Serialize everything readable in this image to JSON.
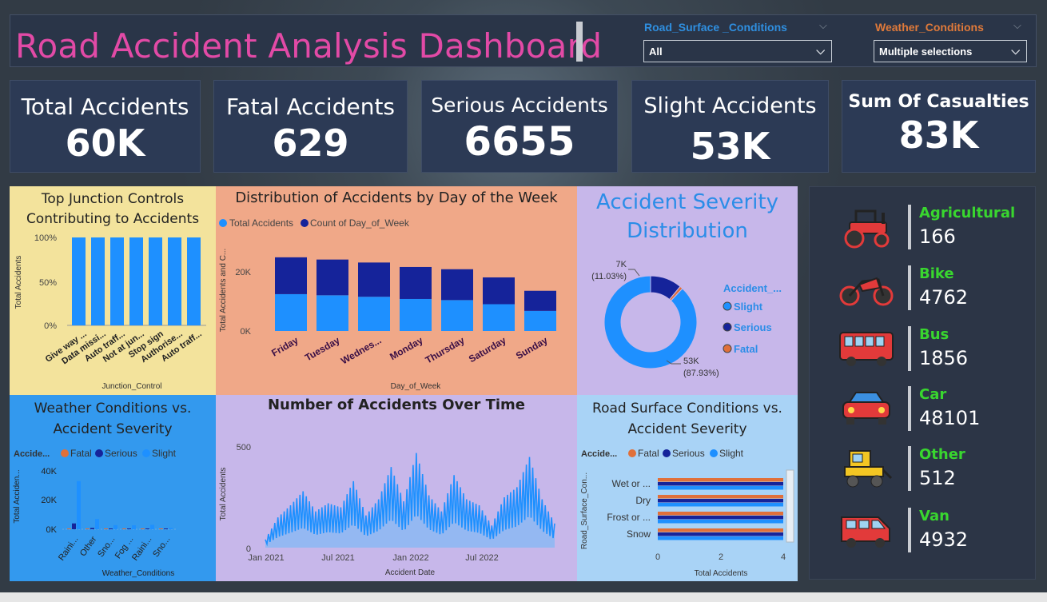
{
  "header": {
    "title": "Road Accident Analysis Dashboard",
    "slicers": [
      {
        "label": "Road_Surface _Conditions",
        "value": "All",
        "label_color": "#2f8fe0"
      },
      {
        "label": "Weather_Conditions",
        "value": "Multiple selections",
        "label_color": "#e07a3a"
      }
    ]
  },
  "kpis": [
    {
      "label": "Total Accidents",
      "value": "60K"
    },
    {
      "label": "Fatal Accidents",
      "value": "629"
    },
    {
      "label": "Serious Accidents",
      "value": "6655"
    },
    {
      "label": "Slight Accidents",
      "value": "53K"
    },
    {
      "label": "Sum Of Casualties",
      "value": "83K"
    }
  ],
  "junction": {
    "title_line1": "Top Junction Controls",
    "title_line2": "Contributing to Accidents",
    "ylabel": "Total Accidents",
    "xlabel": "Junction_Control",
    "yticks": [
      "100%",
      "50%",
      "0%"
    ]
  },
  "dayweek": {
    "title": "Distribution of Accidents by Day of the Week",
    "legend": [
      "Total Accidents",
      "Count of Day_of_Week"
    ],
    "ylabel": "Total Accidents and C...",
    "xlabel": "Day_of_Week",
    "yticks": [
      "20K",
      "0K"
    ]
  },
  "severity": {
    "title_line1": "Accident Severity",
    "title_line2": "Distribution",
    "legend_title": "Accident_...",
    "legend": [
      "Slight",
      "Serious",
      "Fatal"
    ],
    "label_serious_1": "7K",
    "label_serious_2": "(11.03%)",
    "label_slight_1": "53K",
    "label_slight_2": "(87.93%)"
  },
  "weather": {
    "title_line1": "Weather Conditions vs.",
    "title_line2": "Accident Severity",
    "legend_title": "Accide...",
    "legend": [
      "Fatal",
      "Serious",
      "Slight"
    ],
    "ylabel": "Total Acciden...",
    "xlabel": "Weather_Conditions",
    "yticks": [
      "40K",
      "20K",
      "0K"
    ]
  },
  "overtime": {
    "title": "Number of Accidents Over Time",
    "ylabel": "Total Accidents",
    "xlabel": "Accident Date",
    "yticks": [
      "500",
      "0"
    ],
    "xticks": [
      "Jan 2021",
      "Jul 2021",
      "Jan 2022",
      "Jul 2022"
    ]
  },
  "roadsurface": {
    "title_line1": "Road Surface Conditions vs.",
    "title_line2": "Accident Severity",
    "legend_title": "Accide...",
    "legend": [
      "Fatal",
      "Serious",
      "Slight"
    ],
    "ylabel": "Road_Surface_Con...",
    "xlabel": "Total Accidents",
    "xticks": [
      "0",
      "2",
      "4"
    ]
  },
  "vehicles": [
    {
      "name": "Agricultural",
      "value": "166",
      "icon": "tractor-icon"
    },
    {
      "name": "Bike",
      "value": "4762",
      "icon": "motorbike-icon"
    },
    {
      "name": "Bus",
      "value": "1856",
      "icon": "bus-icon"
    },
    {
      "name": "Car",
      "value": "48101",
      "icon": "car-icon"
    },
    {
      "name": "Other",
      "value": "512",
      "icon": "digger-icon"
    },
    {
      "name": "Van",
      "value": "4932",
      "icon": "van-icon"
    }
  ],
  "colors": {
    "slight": "#1e90ff",
    "serious": "#15239a",
    "fatal": "#e0703a",
    "kpi_bg": "#2c3a55",
    "title_pink": "#e24aa6",
    "vehicle_green": "#39d62f"
  },
  "chart_data": [
    {
      "type": "bar",
      "title": "Top Junction Controls Contributing to Accidents",
      "xlabel": "Junction_Control",
      "ylabel": "Total Accidents",
      "categories": [
        "Give way ...",
        "Data missi...",
        "Auto traff...",
        "Not at jun...",
        "Stop sign",
        "Authorise...",
        "Auto traff..."
      ],
      "values": [
        100,
        100,
        100,
        100,
        100,
        100,
        100
      ],
      "ylim": [
        0,
        100
      ],
      "unit": "%"
    },
    {
      "type": "bar",
      "title": "Distribution of Accidents by Day of the Week",
      "xlabel": "Day_of_Week",
      "ylabel": "Total Accidents and C...",
      "categories": [
        "Friday",
        "Tuesday",
        "Wednes...",
        "Monday",
        "Thursday",
        "Saturday",
        "Sunday"
      ],
      "series": [
        {
          "name": "Total Accidents",
          "values": [
            9900,
            9600,
            9200,
            8600,
            8300,
            7200,
            5400
          ]
        },
        {
          "name": "Count of Day_of_Week",
          "values": [
            9900,
            9600,
            9200,
            8600,
            8300,
            7200,
            5400
          ]
        }
      ],
      "stacked": true,
      "ylim": [
        0,
        26000
      ]
    },
    {
      "type": "pie",
      "title": "Accident Severity Distribution",
      "legend_title": "Accident_...",
      "categories": [
        "Slight",
        "Serious",
        "Fatal"
      ],
      "values": [
        87.93,
        11.03,
        1.04
      ]
    },
    {
      "type": "bar",
      "title": "Weather Conditions vs. Accident Severity",
      "xlabel": "Weather_Conditions",
      "ylabel": "Total Acciden...",
      "categories": [
        "Raini...",
        "Other",
        "Sno...",
        "Fog ...",
        "Raini...",
        "Sno..."
      ],
      "series": [
        {
          "name": "Fatal",
          "values": [
            90,
            15,
            10,
            5,
            10,
            2
          ]
        },
        {
          "name": "Serious",
          "values": [
            4000,
            900,
            200,
            150,
            500,
            100
          ]
        },
        {
          "name": "Slight",
          "values": [
            33000,
            7000,
            2800,
            2700,
            3000,
            900
          ]
        }
      ],
      "ylim": [
        0,
        45000
      ]
    },
    {
      "type": "area",
      "title": "Number of Accidents Over Time",
      "xlabel": "Accident Date",
      "ylabel": "Total Accidents",
      "xrange": [
        "Jan 2021",
        "Dec 2022"
      ],
      "ylim": [
        0,
        520
      ],
      "x": [
        "2021-01",
        "2021-02",
        "2021-03",
        "2021-04",
        "2021-05",
        "2021-06",
        "2021-07",
        "2021-08",
        "2021-09",
        "2021-10",
        "2021-11",
        "2021-12",
        "2022-01",
        "2022-02",
        "2022-03",
        "2022-04",
        "2022-05",
        "2022-06",
        "2022-07",
        "2022-08",
        "2022-09",
        "2022-10",
        "2022-11",
        "2022-12"
      ],
      "y": [
        40,
        150,
        210,
        280,
        180,
        220,
        200,
        330,
        160,
        240,
        400,
        230,
        470,
        260,
        180,
        360,
        240,
        210,
        110,
        250,
        300,
        450,
        240,
        120
      ]
    },
    {
      "type": "bar",
      "orientation": "horizontal",
      "title": "Road Surface Conditions vs. Accident Severity",
      "xlabel": "Total Accidents",
      "ylabel": "Road_Surface_Con...",
      "categories": [
        "Wet or ...",
        "Dry",
        "Frost or ...",
        "Snow"
      ],
      "series": [
        {
          "name": "Fatal",
          "values": [
            4,
            4,
            4,
            4
          ]
        },
        {
          "name": "Serious",
          "values": [
            4,
            4,
            4,
            4
          ]
        },
        {
          "name": "Slight",
          "values": [
            4,
            4,
            4,
            4
          ]
        }
      ],
      "xlim": [
        0,
        4
      ]
    }
  ]
}
